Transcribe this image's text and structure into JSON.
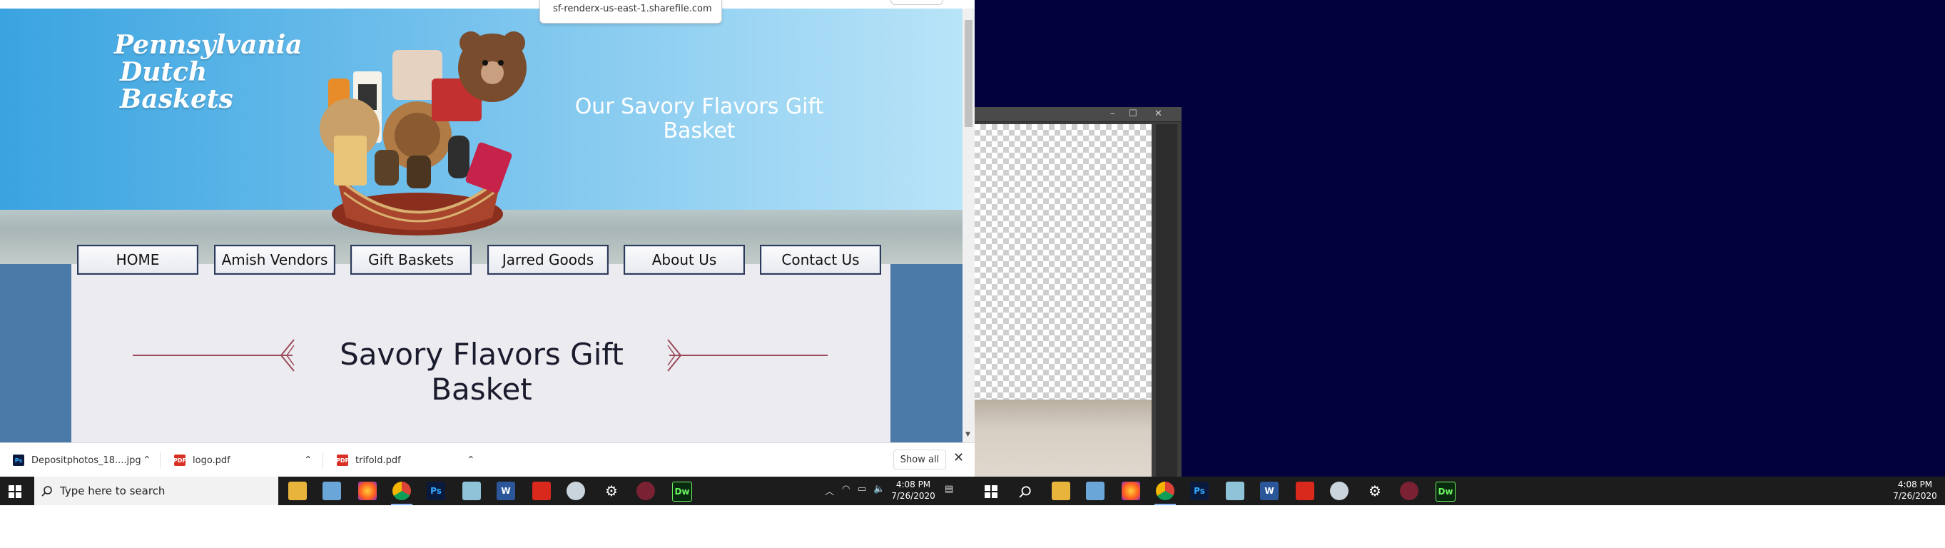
{
  "tooltip": {
    "url": "sf-renderx-us-east-1.sharefile.com"
  },
  "site": {
    "logo_line1": "Pennsylvania",
    "logo_line2": "Dutch Baskets",
    "hero_title_line1": "Our Savory Flavors Gift",
    "hero_title_line2": "Basket",
    "nav": [
      "HOME",
      "Amish Vendors",
      "Gift Baskets",
      "Jarred Goods",
      "About Us",
      "Contact Us"
    ],
    "section_title": "Savory Flavors Gift Basket"
  },
  "downloads": {
    "items": [
      {
        "name": "Depositphotos_18....jpg",
        "icon": "photoshop-file-icon"
      },
      {
        "name": "logo.pdf",
        "icon": "pdf-file-icon"
      },
      {
        "name": "trifold.pdf",
        "icon": "pdf-file-icon"
      }
    ],
    "show_all": "Show all"
  },
  "taskbar_left": {
    "search_placeholder": "Type here to search",
    "time": "4:08 PM",
    "date": "7/26/2020",
    "pinned": [
      "file-explorer-icon",
      "remote-desktop-icon",
      "firefox-icon",
      "chrome-icon",
      "photoshop-icon",
      "notepad-icon",
      "word-icon",
      "acrobat-icon",
      "paint-icon",
      "settings-icon",
      "media-icon",
      "dreamweaver-icon"
    ]
  },
  "taskbar_right": {
    "time": "4:08 PM",
    "date": "7/26/2020",
    "pinned": [
      "file-explorer-icon",
      "remote-desktop-icon",
      "firefox-icon",
      "chrome-icon",
      "photoshop-icon",
      "notepad-icon",
      "word-icon",
      "acrobat-icon",
      "paint-icon",
      "settings-icon",
      "media-icon",
      "dreamweaver-icon"
    ]
  },
  "icons": {
    "ps": "Ps",
    "dw": "Dw",
    "w": "W",
    "pdf": "PDF"
  },
  "colors": {
    "nav_border": "#2d3b5a",
    "side_panel": "#4b7aa8",
    "desktop_bg": "#02013d",
    "taskbar": "#1c1c1c"
  }
}
